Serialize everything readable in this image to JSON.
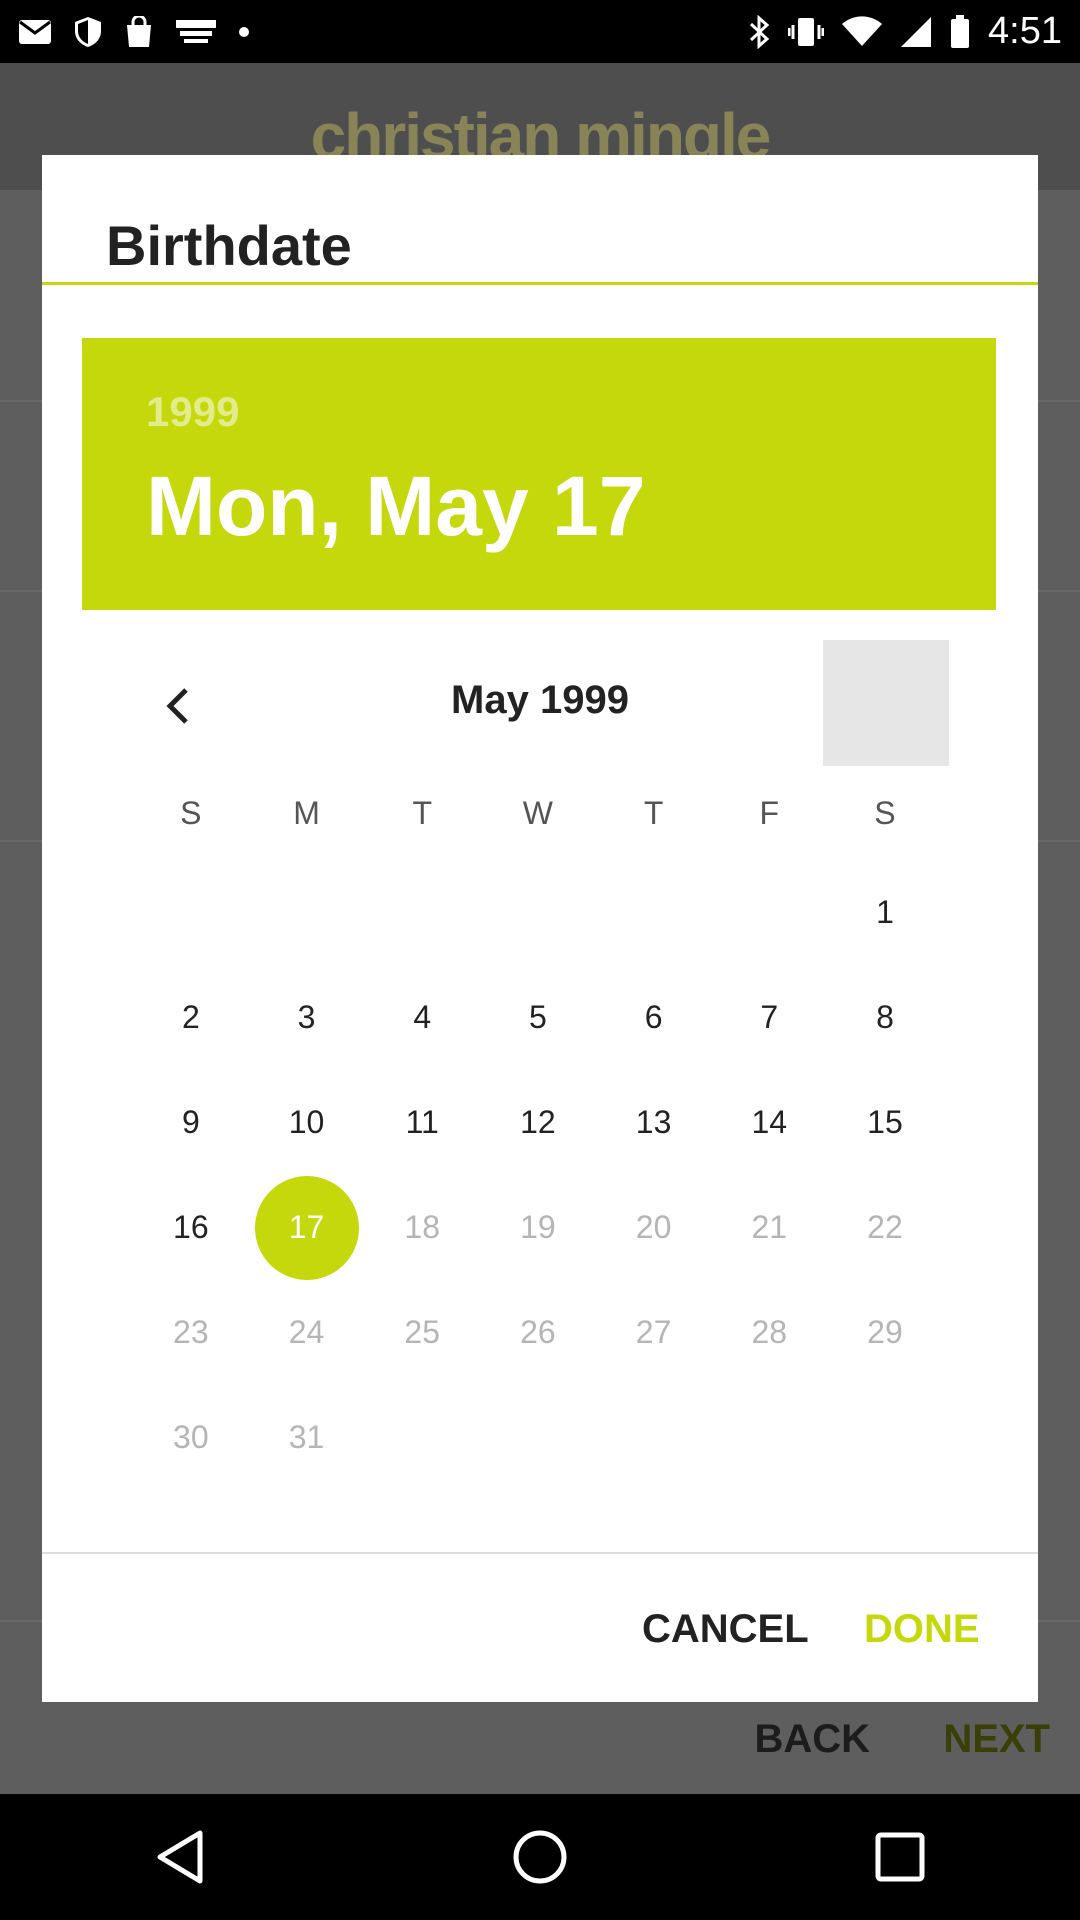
{
  "status_bar": {
    "time": "4:51",
    "left_icons": [
      "mail-icon",
      "shield-icon",
      "bag-icon",
      "espn-icon",
      "dot-icon"
    ],
    "right_icons": [
      "bluetooth-icon",
      "vibrate-icon",
      "wifi-icon",
      "signal-icon",
      "battery-icon"
    ]
  },
  "app": {
    "logo": "christian mingle",
    "bottom_back": "BACK",
    "bottom_next": "NEXT"
  },
  "dialog": {
    "title": "Birthdate",
    "header_year": "1999",
    "header_date": "Mon, May 17",
    "month_label": "May 1999",
    "weekdays": [
      "S",
      "M",
      "T",
      "W",
      "T",
      "F",
      "S"
    ],
    "weeks": [
      [
        "",
        "",
        "",
        "",
        "",
        "",
        "1"
      ],
      [
        "2",
        "3",
        "4",
        "5",
        "6",
        "7",
        "8"
      ],
      [
        "9",
        "10",
        "11",
        "12",
        "13",
        "14",
        "15"
      ],
      [
        "16",
        "17",
        "18",
        "19",
        "20",
        "21",
        "22"
      ],
      [
        "23",
        "24",
        "25",
        "26",
        "27",
        "28",
        "29"
      ],
      [
        "30",
        "31",
        "",
        "",
        "",
        "",
        ""
      ]
    ],
    "selected_day": "17",
    "cancel_label": "CANCEL",
    "done_label": "DONE"
  },
  "colors": {
    "accent": "#c5d80b",
    "disabled_day": "#b5b5b5"
  }
}
